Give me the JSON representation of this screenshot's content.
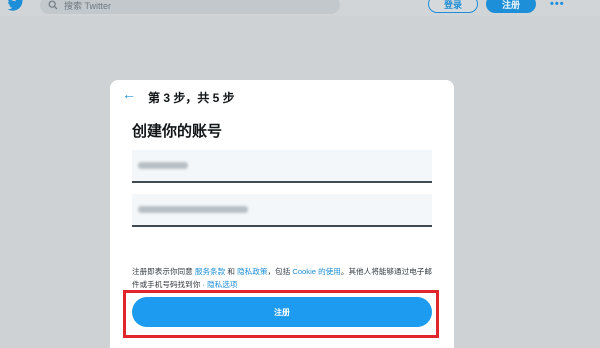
{
  "colors": {
    "brand": "#1d8fd8",
    "overlay": "#cfd2d4",
    "highlight": "#e0262b"
  },
  "topbar": {
    "logo_icon": "twitter-bird-icon",
    "search_placeholder": "搜索 Twitter",
    "search_icon": "search-icon",
    "login_label": "登录",
    "signup_label": "注册",
    "more_label": "•••"
  },
  "modal": {
    "back_icon": "back-arrow-icon",
    "back_glyph": "←",
    "step": "第 3 步，共 5 步",
    "heading": "创建你的账号",
    "fields": {
      "name_value": "",
      "email_value": ""
    },
    "terms": {
      "text1": "注册即表示你同意 ",
      "link_tos": "服务条款",
      "text2": " 和 ",
      "link_privacy": "隐私政策",
      "text3": "，包括 ",
      "link_cookie": "Cookie 的使用",
      "text4": "。其他人将能够通过电子邮件或手机号码找到你 · ",
      "link_options": "隐私选项"
    },
    "submit_label": "注册"
  }
}
